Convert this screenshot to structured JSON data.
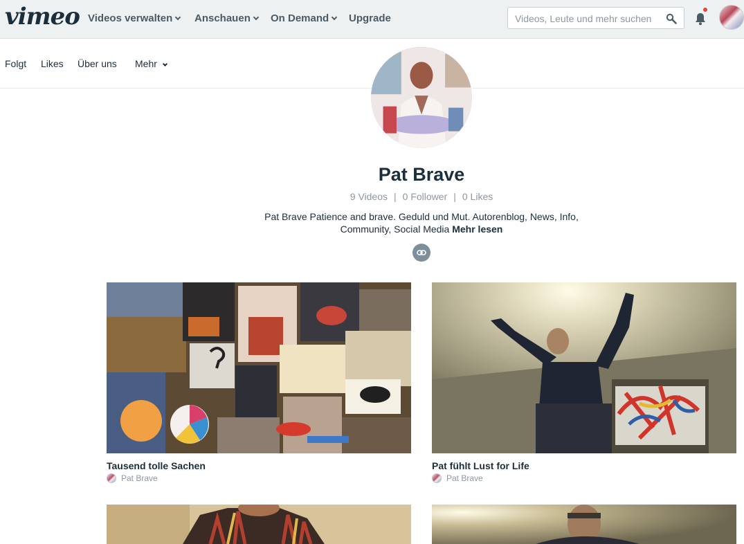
{
  "header": {
    "logo": "vimeo",
    "nav": [
      {
        "label": "Videos verwalten",
        "has_dropdown": true
      },
      {
        "label": "Anschauen",
        "has_dropdown": true
      },
      {
        "label": "On Demand",
        "has_dropdown": true
      },
      {
        "label": "Upgrade",
        "has_dropdown": false
      }
    ],
    "search": {
      "placeholder": "Videos, Leute und mehr suchen",
      "value": ""
    },
    "icons": {
      "search": "search-icon",
      "notifications": "bell-icon",
      "avatar": "user-avatar"
    },
    "notification_dot_color": "#e7453c"
  },
  "subnav": {
    "items": [
      {
        "label": "Folgt"
      },
      {
        "label": "Likes"
      },
      {
        "label": "Über uns"
      },
      {
        "label": "Mehr",
        "has_dropdown": true
      }
    ]
  },
  "profile": {
    "name": "Pat Brave",
    "stats": {
      "videos": "9 Videos",
      "followers": "0 Follower",
      "likes": "0 Likes",
      "separator": "|"
    },
    "bio": "Pat Brave Patience and brave. Geduld und Mut. Autorenblog, News, Info, Community, Social Media",
    "read_more": "Mehr lesen",
    "link_icon": "link-icon"
  },
  "videos": [
    {
      "title": "Tausend tolle Sachen",
      "author": "Pat Brave"
    },
    {
      "title": "Pat fühlt Lust for Life",
      "author": "Pat Brave"
    },
    {
      "title": "",
      "author": ""
    },
    {
      "title": "",
      "author": ""
    }
  ],
  "colors": {
    "text": "#1a2e3b",
    "muted": "#8b989f",
    "topbar_bg": "#eef1f2",
    "link_button": "#7d8f9a"
  }
}
